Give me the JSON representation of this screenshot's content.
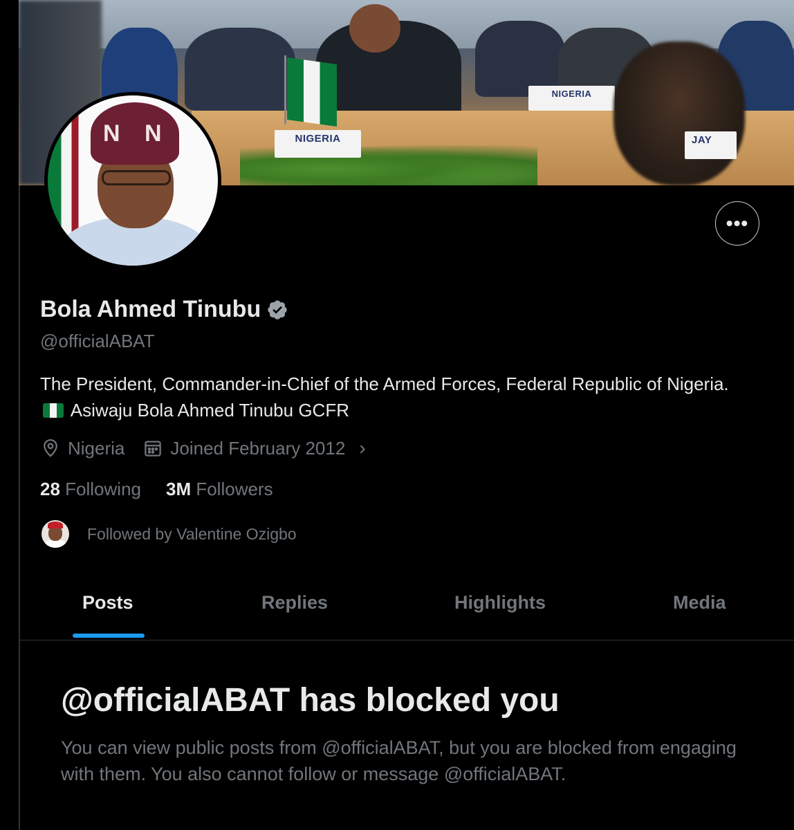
{
  "banner": {
    "nameplates": [
      "NIGERIA",
      "NIGERIA",
      "JAY"
    ]
  },
  "profile": {
    "display_name": "Bola Ahmed Tinubu",
    "handle": "@officialABAT",
    "bio_part1": "The President, Commander-in-Chief of the Armed Forces, Federal Republic of Nigeria.",
    "bio_part2": "Asiwaju Bola Ahmed Tinubu GCFR",
    "location": "Nigeria",
    "joined": "Joined February 2012",
    "following_count": "28",
    "following_label": "Following",
    "followers_count": "3M",
    "followers_label": "Followers",
    "followed_by": "Followed by Valentine Ozigbo",
    "more_label": "•••"
  },
  "tabs": [
    {
      "label": "Posts",
      "active": true
    },
    {
      "label": "Replies",
      "active": false
    },
    {
      "label": "Highlights",
      "active": false
    },
    {
      "label": "Media",
      "active": false
    }
  ],
  "blocked": {
    "title": "@officialABAT has blocked you",
    "body": "You can view public posts from @officialABAT, but you are blocked from engaging with them. You also cannot follow or message @officialABAT."
  },
  "colors": {
    "background": "#000000",
    "text_primary": "#e7e9ea",
    "text_secondary": "#71767b",
    "accent": "#1d9bf0",
    "divider": "#2f3336"
  },
  "icons": [
    "verified-badge-icon",
    "location-pin-icon",
    "calendar-icon",
    "chevron-right-icon",
    "more-options-icon",
    "nigeria-flag-emoji"
  ]
}
